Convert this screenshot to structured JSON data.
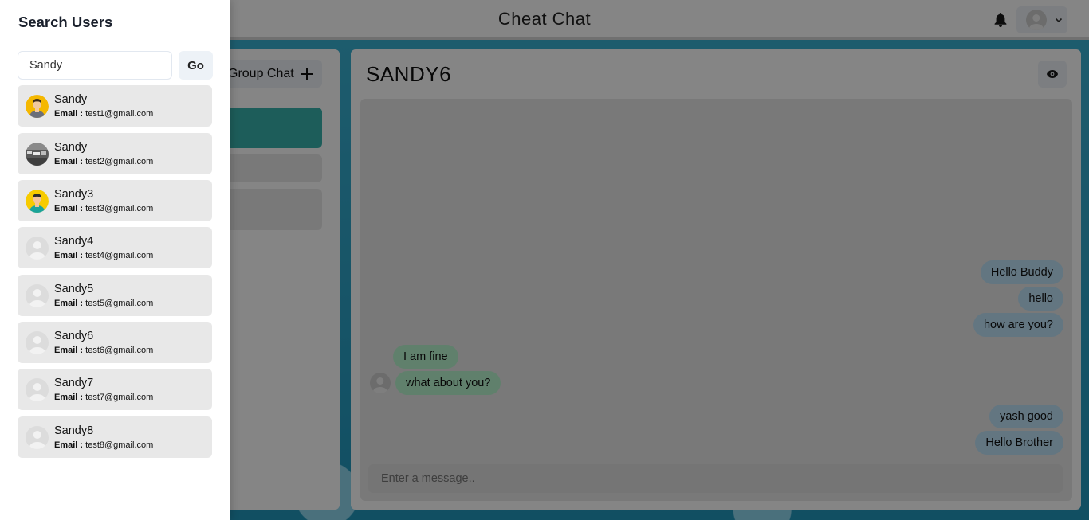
{
  "app": {
    "title": "Cheat Chat",
    "accent": "#38b2ac"
  },
  "sidebar_chats": {
    "group_chat_label": "Group Chat"
  },
  "conversation": {
    "title": "SANDY6",
    "input_placeholder": "Enter a message..",
    "messages": [
      {
        "text": "Hello Buddy",
        "direction": "out"
      },
      {
        "text": "hello",
        "direction": "out"
      },
      {
        "text": "how are you?",
        "direction": "out"
      },
      {
        "text": "I am fine",
        "direction": "in"
      },
      {
        "text": "what about you?",
        "direction": "in"
      },
      {
        "text": "yash good",
        "direction": "out"
      },
      {
        "text": "Hello Brother",
        "direction": "out"
      }
    ]
  },
  "drawer": {
    "title": "Search Users",
    "search_value": "Sandy",
    "go_label": "Go",
    "email_label": "Email :",
    "results": [
      {
        "name": "Sandy",
        "email": "test1@gmail.com",
        "avatar": "man-avatar-icon"
      },
      {
        "name": "Sandy",
        "email": "test2@gmail.com",
        "avatar": "photo-avatar"
      },
      {
        "name": "Sandy3",
        "email": "test3@gmail.com",
        "avatar": "boy-avatar-icon"
      },
      {
        "name": "Sandy4",
        "email": "test4@gmail.com",
        "avatar": "default-avatar-icon"
      },
      {
        "name": "Sandy5",
        "email": "test5@gmail.com",
        "avatar": "default-avatar-icon"
      },
      {
        "name": "Sandy6",
        "email": "test6@gmail.com",
        "avatar": "default-avatar-icon"
      },
      {
        "name": "Sandy7",
        "email": "test7@gmail.com",
        "avatar": "default-avatar-icon"
      },
      {
        "name": "Sandy8",
        "email": "test8@gmail.com",
        "avatar": "default-avatar-icon"
      }
    ]
  }
}
